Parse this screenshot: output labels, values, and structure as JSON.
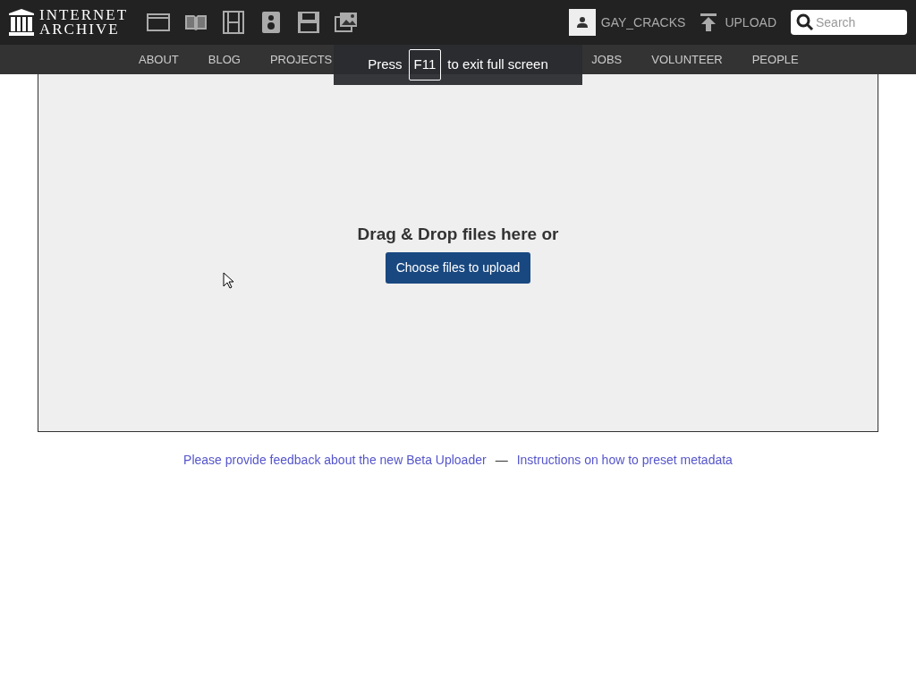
{
  "logo": {
    "line_1": "INTERNET",
    "line_2": "ARCHIVE"
  },
  "media_icons": [
    {
      "kind": "web"
    },
    {
      "kind": "texts"
    },
    {
      "kind": "video"
    },
    {
      "kind": "audio"
    },
    {
      "kind": "software"
    },
    {
      "kind": "images"
    }
  ],
  "user": {
    "name": "GAY_CRACKS"
  },
  "upload": {
    "label": "UPLOAD"
  },
  "search": {
    "placeholder": "Search"
  },
  "nav": [
    "ABOUT",
    "BLOG",
    "PROJECTS",
    "JOBS",
    "VOLUNTEER",
    "PEOPLE"
  ],
  "fullscreen_notice": {
    "before": "Press",
    "key": "F11",
    "after": "to exit full screen"
  },
  "dropzone": {
    "text": "Drag & Drop files here or",
    "button": "Choose files to upload"
  },
  "footer": {
    "link_1": "Please provide feedback about the new Beta Uploader",
    "separator": "—",
    "link_2": "Instructions on how to preset metadata"
  }
}
